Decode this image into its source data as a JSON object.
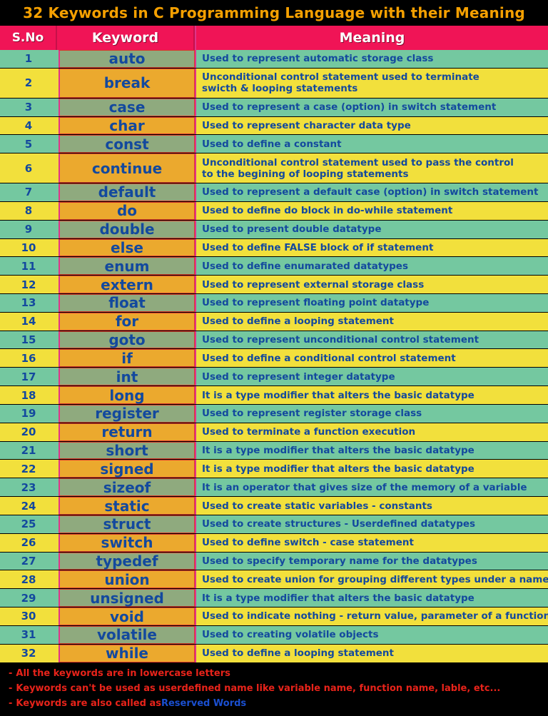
{
  "title": "32 Keywords in C Programming Language with their Meaning",
  "colors": {
    "title_text": "#F5A000",
    "title_bg": "#000000",
    "header_bg": "#F01456",
    "header_text": "#FFFFFF",
    "row_odd": "#74C8A0",
    "row_even": "#F2E03C",
    "keyword_odd": "#8FAA7E",
    "keyword_even": "#EBA92E",
    "body_text": "#13499E",
    "note_text": "#E8231A",
    "note_highlight": "#1A4FD0"
  },
  "header": {
    "sno": "S.No",
    "keyword": "Keyword",
    "meaning": "Meaning"
  },
  "rows": [
    {
      "sno": "1",
      "keyword": "auto",
      "meaning": [
        "Used to represent automatic storage class"
      ]
    },
    {
      "sno": "2",
      "keyword": "break",
      "meaning": [
        "Unconditional control statement used to terminate",
        "swicth & looping statements"
      ]
    },
    {
      "sno": "3",
      "keyword": "case",
      "meaning": [
        "Used to represent a case (option) in switch statement"
      ]
    },
    {
      "sno": "4",
      "keyword": "char",
      "meaning": [
        "Used to represent character data type"
      ]
    },
    {
      "sno": "5",
      "keyword": "const",
      "meaning": [
        "Used to define a constant"
      ]
    },
    {
      "sno": "6",
      "keyword": "continue",
      "meaning": [
        "Unconditional control statement used to pass the control",
        "to the begining of looping statements"
      ]
    },
    {
      "sno": "7",
      "keyword": "default",
      "meaning": [
        "Used to represent a default case (option) in switch statement"
      ]
    },
    {
      "sno": "8",
      "keyword": "do",
      "meaning": [
        "Used to define do block in do-while statement"
      ]
    },
    {
      "sno": "9",
      "keyword": "double",
      "meaning": [
        "Used to present double datatype"
      ]
    },
    {
      "sno": "10",
      "keyword": "else",
      "meaning": [
        "Used to define FALSE block of if statement"
      ]
    },
    {
      "sno": "11",
      "keyword": "enum",
      "meaning": [
        "Used to define enumarated datatypes"
      ]
    },
    {
      "sno": "12",
      "keyword": "extern",
      "meaning": [
        "Used to represent external storage class"
      ]
    },
    {
      "sno": "13",
      "keyword": "float",
      "meaning": [
        "Used to represent floating point datatype"
      ]
    },
    {
      "sno": "14",
      "keyword": "for",
      "meaning": [
        "Used to define a looping statement"
      ]
    },
    {
      "sno": "15",
      "keyword": "goto",
      "meaning": [
        "Used to represent unconditional control statement"
      ]
    },
    {
      "sno": "16",
      "keyword": "if",
      "meaning": [
        "Used to define a conditional control statement"
      ]
    },
    {
      "sno": "17",
      "keyword": "int",
      "meaning": [
        "Used to represent integer datatype"
      ]
    },
    {
      "sno": "18",
      "keyword": "long",
      "meaning": [
        "It is a type modifier that alters the basic datatype"
      ]
    },
    {
      "sno": "19",
      "keyword": "register",
      "meaning": [
        "Used to represent register storage class"
      ]
    },
    {
      "sno": "20",
      "keyword": "return",
      "meaning": [
        "Used to terminate a function execution"
      ]
    },
    {
      "sno": "21",
      "keyword": "short",
      "meaning": [
        "It is a type modifier that alters the basic datatype"
      ]
    },
    {
      "sno": "22",
      "keyword": "signed",
      "meaning": [
        "It is a type modifier that alters the basic datatype"
      ]
    },
    {
      "sno": "23",
      "keyword": "sizeof",
      "meaning": [
        "It is an operator that gives size of the memory of a variable"
      ]
    },
    {
      "sno": "24",
      "keyword": "static",
      "meaning": [
        "Used to create static variables - constants"
      ]
    },
    {
      "sno": "25",
      "keyword": "struct",
      "meaning": [
        "Used to create structures - Userdefined datatypes"
      ]
    },
    {
      "sno": "26",
      "keyword": "switch",
      "meaning": [
        "Used to define switch - case statement"
      ]
    },
    {
      "sno": "27",
      "keyword": "typedef",
      "meaning": [
        "Used to specify temporary name for the datatypes"
      ]
    },
    {
      "sno": "28",
      "keyword": "union",
      "meaning": [
        "Used to create union for grouping different types under a name"
      ]
    },
    {
      "sno": "29",
      "keyword": "unsigned",
      "meaning": [
        "It is a type modifier that alters the basic datatype"
      ]
    },
    {
      "sno": "30",
      "keyword": "void",
      "meaning": [
        "Used to indicate nothing - return value, parameter of a function"
      ]
    },
    {
      "sno": "31",
      "keyword": "volatile",
      "meaning": [
        "Used to creating volatile objects"
      ]
    },
    {
      "sno": "32",
      "keyword": "while",
      "meaning": [
        "Used to define a looping statement"
      ]
    }
  ],
  "notes": [
    {
      "bullet": "-",
      "text": "All the keywords are in lowercase letters",
      "highlight": ""
    },
    {
      "bullet": "-",
      "text": "Keywords can't be used as userdefined name like variable name, function name, lable, etc...",
      "highlight": ""
    },
    {
      "bullet": "-",
      "text": "Keywords are also called as ",
      "highlight": "Reserved Words"
    }
  ]
}
